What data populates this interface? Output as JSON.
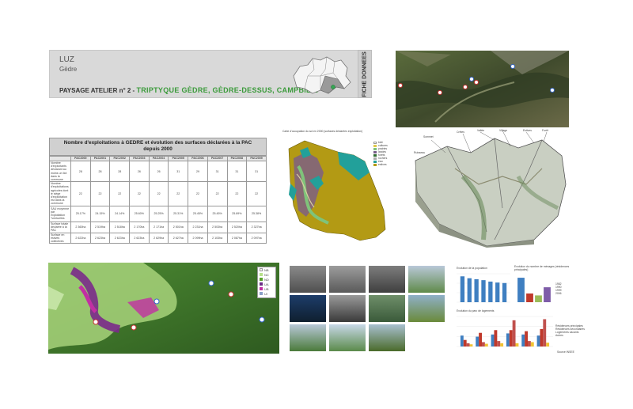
{
  "header": {
    "site": "LUZ",
    "commune": "Gèdre",
    "atelier_label": "PAYSAGE ATELIER n° 2 - ",
    "atelier_title": "TRIPTYQUE GÈDRE, GÈDRE-DESSUS, CAMPBIEIL",
    "fiche_label": "FICHE DONNEES"
  },
  "table": {
    "title_line1": "Nombre d'exploitations à GEDRE et évolution des surfaces déclarées à la PAC",
    "title_line2": "depuis 2000",
    "columns": [
      "",
      "PAC2000",
      "PAC2001",
      "PAC2002",
      "PAC2003",
      "PAC2004",
      "PAC2005",
      "PAC2006",
      "PAC2007",
      "PAC2008",
      "PAC2009"
    ],
    "rows": [
      {
        "label": "Nombre d'exploitants déclarant au moins un îlot dans la commune",
        "values": [
          "28",
          "28",
          "28",
          "26",
          "26",
          "31",
          "29",
          "31",
          "31",
          "31"
        ]
      },
      {
        "label": "Nombre d'exploitations agricoles dont le siège d'exploitation est dans la commune",
        "values": [
          "22",
          "22",
          "22",
          "22",
          "22",
          "22",
          "22",
          "22",
          "22",
          "22"
        ]
      },
      {
        "label": "SAU moyenne par exploitation *ventuelles",
        "values": [
          "25.17%",
          "24.15%",
          "24.14%",
          "25.60%",
          "25.25%",
          "25.31%",
          "25.45%",
          "25.45%",
          "25.89%",
          "25.38%"
        ]
      },
      {
        "label": "Surface totale déclarée à la PAC",
        "values": [
          "2 360ha",
          "2 519ha",
          "2 518ha",
          "2 170ha",
          "2 171ha",
          "2 501ha",
          "2 231ha",
          "2 503ha",
          "2 520ha",
          "2 327ha"
        ]
      },
      {
        "label": "Surface en estives collectives",
        "values": [
          "2 622ha",
          "2 623ha",
          "2 623ha",
          "2 623ha",
          "2 629ha",
          "2 627ha",
          "2 099ha",
          "2 103ha",
          "2 087ha",
          "2 097ha"
        ]
      }
    ]
  },
  "zoning_legend": [
    "NB",
    "NC",
    "ND",
    "UA",
    "UB",
    "UI"
  ],
  "colors": {
    "accent_green": "#3a9a3a",
    "legend": [
      "#f3f3f3",
      "#b7e08a",
      "#5aa02c",
      "#6b2d86",
      "#c22fa3",
      "#8aa0c8"
    ]
  },
  "landuse_title": "Carte d'occupation du sol en 2000 (surfaces déclarées exploitation)",
  "landuse_legend": [
    "bâti",
    "cultures",
    "prairies",
    "landes",
    "forêts",
    "rochers",
    "eau",
    "estives"
  ],
  "diagram_labels": [
    "Sommet",
    "Crêtes",
    "Vallée",
    "Village",
    "Estives",
    "Forêt",
    "Ruisseau"
  ],
  "chart_pop": {
    "type": "bar",
    "title": "Evolution de la population",
    "values": [
      270,
      250,
      240,
      230,
      215,
      205,
      200
    ]
  },
  "chart_households": {
    "type": "bar",
    "title": "Evolution du nombre de ménages (résidences principales)",
    "values": [
      90,
      32,
      25,
      55
    ],
    "legend": [
      "1982",
      "1990",
      "1999",
      "2006"
    ]
  },
  "chart_housing": {
    "type": "bar",
    "title": "Evolution du parc de logements",
    "series": [
      {
        "name": "",
        "values": [
          20,
          18,
          22,
          24,
          22,
          20
        ]
      },
      {
        "name": "",
        "values": [
          12,
          25,
          30,
          30,
          28,
          32
        ]
      },
      {
        "name": "",
        "values": [
          6,
          8,
          10,
          48,
          10,
          50
        ]
      },
      {
        "name": "",
        "values": [
          4,
          5,
          6,
          6,
          8,
          7
        ]
      }
    ],
    "legend": [
      "Résidences principales",
      "Résidences secondaires",
      "Logements vacants",
      "Autres"
    ],
    "source": "Source INSEE"
  }
}
